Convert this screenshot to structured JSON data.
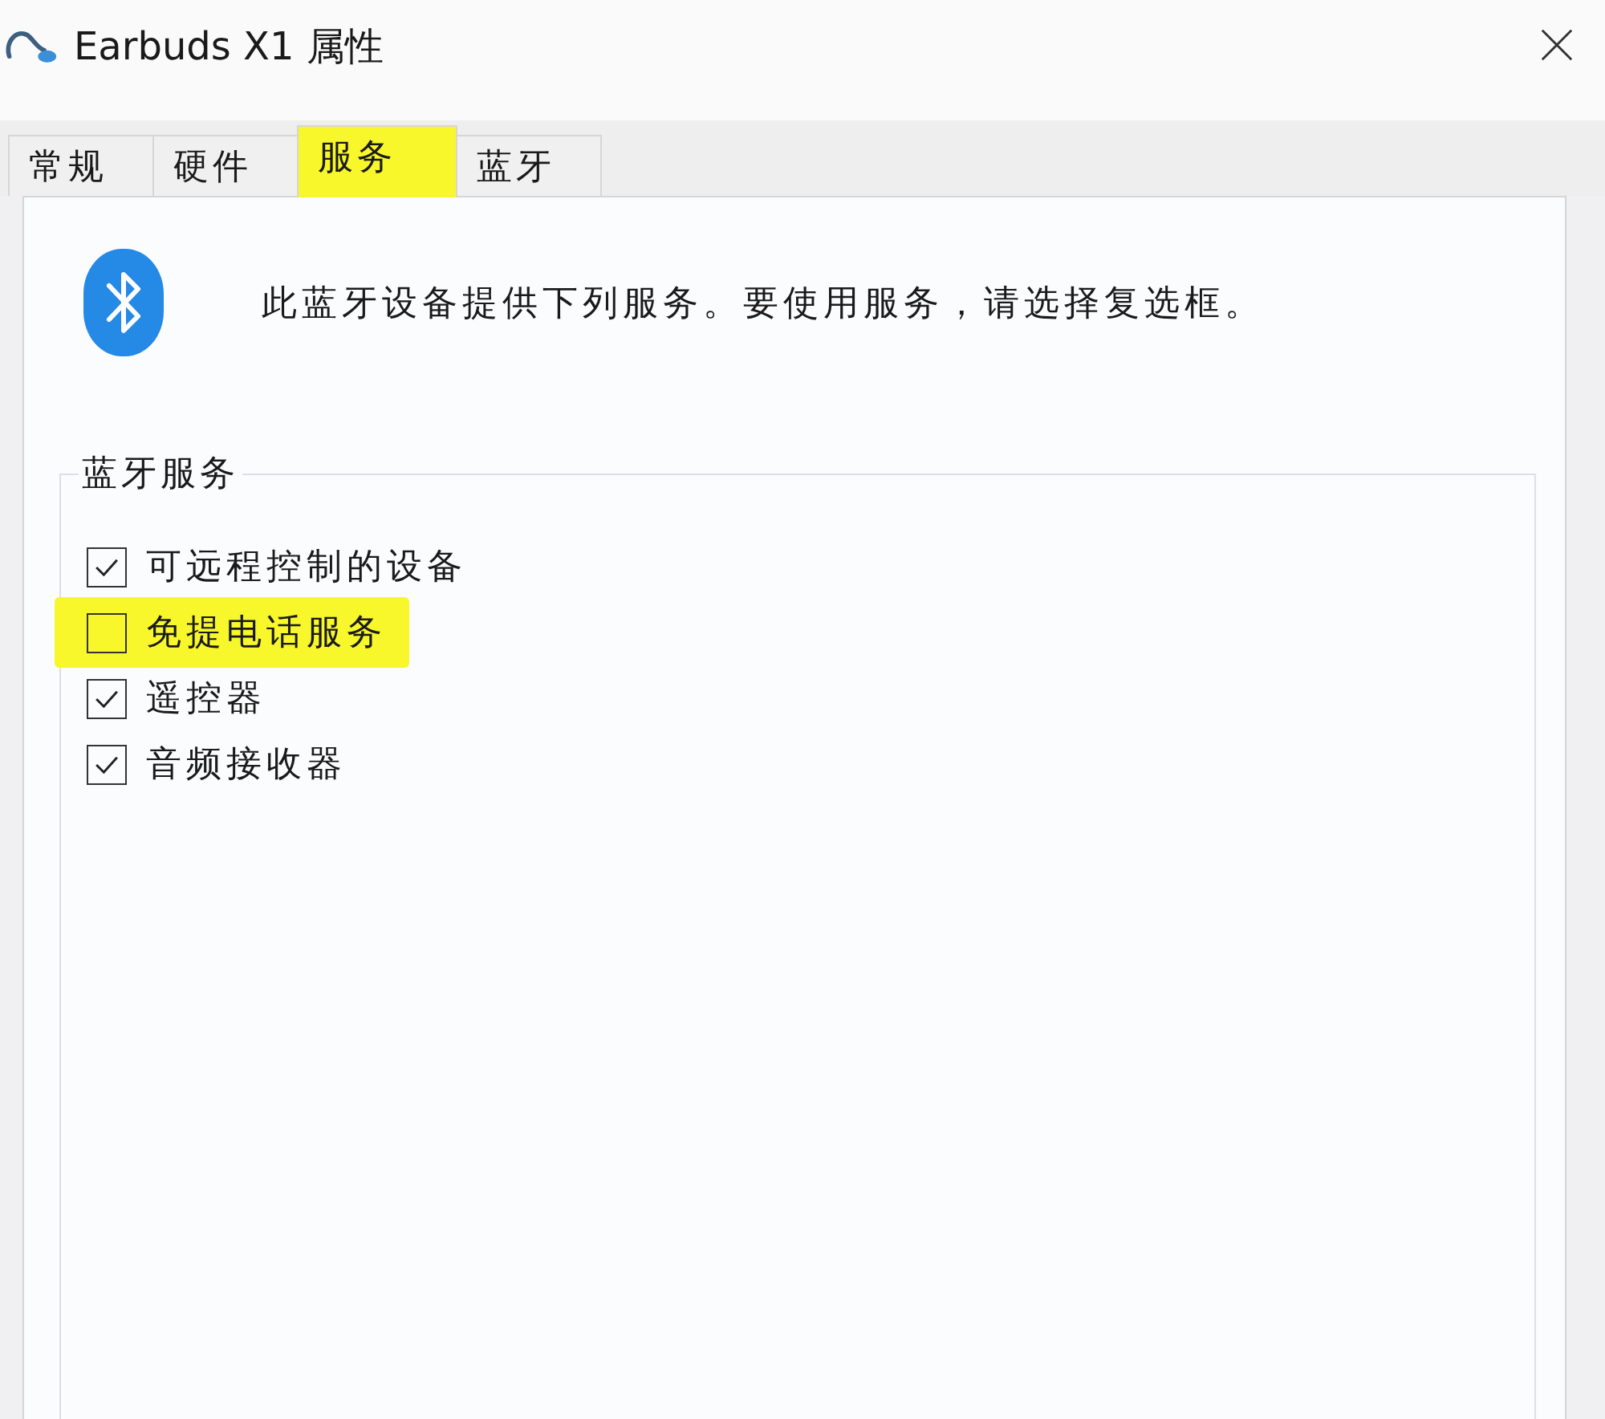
{
  "window": {
    "title": "Earbuds X1 属性"
  },
  "tabs": [
    {
      "label": "常规",
      "selected": false,
      "highlighted": false
    },
    {
      "label": "硬件",
      "selected": false,
      "highlighted": false
    },
    {
      "label": "服务",
      "selected": true,
      "highlighted": true
    },
    {
      "label": "蓝牙",
      "selected": false,
      "highlighted": false
    }
  ],
  "header": {
    "description": "此蓝牙设备提供下列服务。要使用服务，请选择复选框。"
  },
  "services_group": {
    "title": "蓝牙服务",
    "items": [
      {
        "label": "可远程控制的设备",
        "checked": true,
        "highlighted": false
      },
      {
        "label": "免提电话服务",
        "checked": false,
        "highlighted": true
      },
      {
        "label": "遥控器",
        "checked": true,
        "highlighted": false
      },
      {
        "label": "音频接收器",
        "checked": true,
        "highlighted": false
      }
    ]
  }
}
